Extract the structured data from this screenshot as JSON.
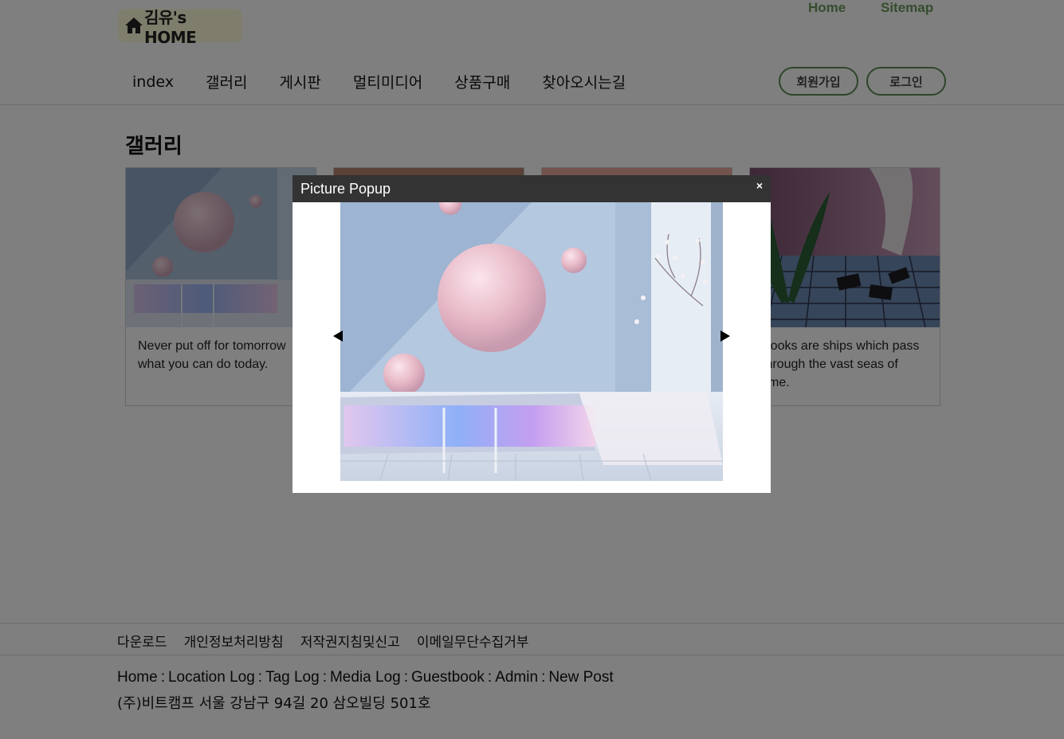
{
  "header": {
    "logo_text": "김유's HOME",
    "top_links": {
      "home": "Home",
      "sitemap": "Sitemap"
    },
    "nav": [
      "index",
      "갤러리",
      "게시판",
      "멀티미디어",
      "상품구매",
      "찾아오시는길"
    ],
    "auth": {
      "join": "회원가입",
      "login": "로그인"
    }
  },
  "main": {
    "title": "갤러리",
    "cards": [
      {
        "text": "Never put off for tomorrow what you can do today."
      },
      {
        "text": ""
      },
      {
        "text": ""
      },
      {
        "text": "Books are ships which pass through the vast seas of time."
      }
    ]
  },
  "popup": {
    "title": "Picture Popup",
    "close": "×",
    "prev_icon": "triangle-left-icon",
    "next_icon": "triangle-right-icon"
  },
  "footer": {
    "links": [
      "다운로드",
      "개인정보처리방침",
      "저작권지침및신고",
      "이메일무단수집거부"
    ],
    "nav": [
      "Home",
      "Location Log",
      "Tag Log",
      "Media Log",
      "Guestbook",
      "Admin",
      "New Post"
    ],
    "address": "(주)비트캠프 서울 강남구 94길 20 삼오빌딩 501호"
  },
  "colors": {
    "logo_bg": "#fffbd9",
    "accent_green": "#5c8b54",
    "popup_header": "#333333",
    "overlay": "rgba(0,0,0,0.5)"
  }
}
